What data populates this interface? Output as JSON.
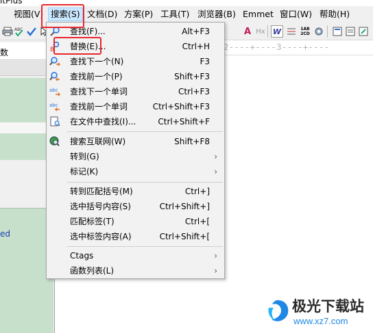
{
  "title_fragment": "ltPlus",
  "menubar": {
    "items": [
      {
        "label": "视图(V)"
      },
      {
        "label": "搜索(S)"
      },
      {
        "label": "文档(D)"
      },
      {
        "label": "方案(P)"
      },
      {
        "label": "工具(T)"
      },
      {
        "label": "浏览器(B)"
      },
      {
        "label": "Emmet"
      },
      {
        "label": "窗口(W)"
      },
      {
        "label": "帮助(H)"
      }
    ],
    "active_label": "搜索(S)"
  },
  "toolbar": {
    "icons": [
      "print-icon",
      "spellcheck-icon",
      "check-icon",
      "font-size-icon",
      "hx-icon",
      "word-wrap-icon",
      "line-numbers-icon",
      "ruler-icon",
      "settings-icon",
      "view-icon",
      "view-2-icon",
      "view-3-icon",
      "view-4-icon"
    ],
    "labels": {
      "font_size": "A",
      "hx": "Hx",
      "word_wrap": "W",
      "abc_cd": "1AB\n2CD"
    }
  },
  "left_panel": {
    "tab_label": "数",
    "item_fragment": "ed"
  },
  "editor": {
    "ruler_text": "2----+----3----+----"
  },
  "search_menu": {
    "items": [
      {
        "icon": "find-icon",
        "label": "查找(F)...",
        "shortcut": "Alt+F3"
      },
      {
        "icon": "replace-icon",
        "label": "替换(E)...",
        "shortcut": "Ctrl+H"
      },
      {
        "icon": "find-next-icon",
        "label": "查找下一个(N)",
        "shortcut": "F3"
      },
      {
        "icon": "find-prev-icon",
        "label": "查找前一个(P)",
        "shortcut": "Shift+F3"
      },
      {
        "icon": "find-next-word-icon",
        "label": "查找下一个单词",
        "shortcut": "Ctrl+F3"
      },
      {
        "icon": "find-prev-word-icon",
        "label": "查找前一个单词",
        "shortcut": "Ctrl+Shift+F3"
      },
      {
        "icon": "find-in-files-icon",
        "label": "在文件中查找(I)...",
        "shortcut": "Ctrl+Shift+F"
      },
      {
        "icon": "search-web-icon",
        "label": "搜索互联网(W)",
        "shortcut": "Shift+F8"
      },
      {
        "icon": "",
        "label": "转到(G)",
        "shortcut": ""
      },
      {
        "icon": "",
        "label": "标记(K)",
        "shortcut": ""
      },
      {
        "icon": "",
        "label": "转到匹配括号(M)",
        "shortcut": "Ctrl+]"
      },
      {
        "icon": "",
        "label": "选中括号内容(S)",
        "shortcut": "Ctrl+Shift+]"
      },
      {
        "icon": "",
        "label": "匹配标签(T)",
        "shortcut": "Ctrl+["
      },
      {
        "icon": "",
        "label": "选中标签内容(A)",
        "shortcut": "Ctrl+Shift+["
      },
      {
        "icon": "",
        "label": "Ctags",
        "shortcut": ""
      },
      {
        "icon": "",
        "label": "函数列表(L)",
        "shortcut": ""
      }
    ],
    "submenu_arrow": "›"
  },
  "watermark": {
    "text": "极光下载站",
    "url": "www.xz7.com"
  },
  "colors": {
    "highlight_red": "#e8262b",
    "menu_hover": "#cde6f7",
    "panel_green": "#c7e0cb",
    "watermark_blue": "#1e88e5"
  }
}
